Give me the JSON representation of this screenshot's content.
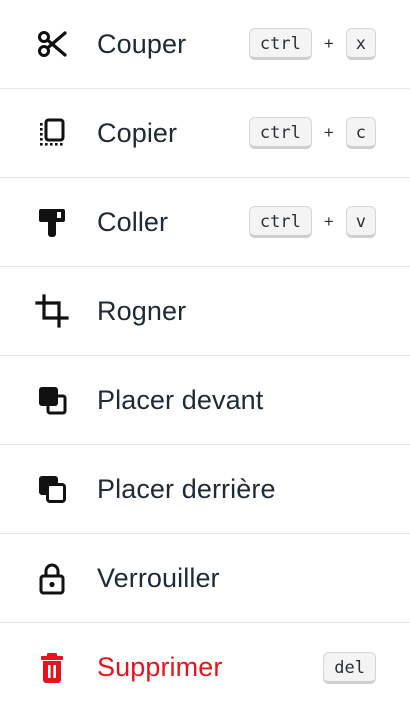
{
  "menu": {
    "items": [
      {
        "icon": "scissors-icon",
        "label": "Couper",
        "keys": [
          "ctrl",
          "x"
        ],
        "plus": "+"
      },
      {
        "icon": "copy-icon",
        "label": "Copier",
        "keys": [
          "ctrl",
          "c"
        ],
        "plus": "+"
      },
      {
        "icon": "paste-icon",
        "label": "Coller",
        "keys": [
          "ctrl",
          "v"
        ],
        "plus": "+"
      },
      {
        "icon": "crop-icon",
        "label": "Rogner"
      },
      {
        "icon": "bring-to-front-icon",
        "label": "Placer devant"
      },
      {
        "icon": "send-to-back-icon",
        "label": "Placer derrière"
      },
      {
        "icon": "lock-icon",
        "label": "Verrouiller"
      },
      {
        "icon": "trash-icon",
        "label": "Supprimer",
        "keys": [
          "del"
        ]
      }
    ]
  },
  "colors": {
    "text": "#1e2a36",
    "danger": "#e8141b",
    "divider": "#e8e8e8"
  }
}
